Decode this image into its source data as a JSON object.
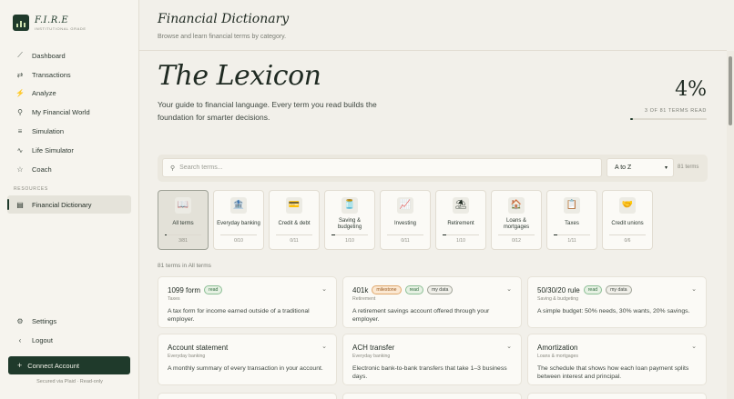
{
  "brand": {
    "name": "F.I.R.E",
    "tagline": "INSTITUTIONAL GRADE"
  },
  "nav": [
    {
      "label": "Dashboard",
      "icon": "chart-line-icon",
      "glyph": "⟋"
    },
    {
      "label": "Transactions",
      "icon": "arrows-swap-icon",
      "glyph": "⇄"
    },
    {
      "label": "Analyze",
      "icon": "pulse-icon",
      "glyph": "⚡"
    },
    {
      "label": "My Financial World",
      "icon": "microphone-icon",
      "glyph": "⚲"
    },
    {
      "label": "Simulation",
      "icon": "sliders-icon",
      "glyph": "≡"
    },
    {
      "label": "Life Simulator",
      "icon": "pulse-line-icon",
      "glyph": "∿"
    },
    {
      "label": "Coach",
      "icon": "star-icon",
      "glyph": "☆"
    }
  ],
  "resources_label": "RESOURCES",
  "active_item": {
    "label": "Financial Dictionary",
    "icon": "book-icon",
    "glyph": "▤"
  },
  "bottom_nav": [
    {
      "label": "Settings",
      "icon": "gear-icon",
      "glyph": "⚙"
    },
    {
      "label": "Logout",
      "icon": "chevron-left-icon",
      "glyph": "‹"
    }
  ],
  "connect": {
    "label": "Connect Account",
    "secured": "Secured via Plaid · Read-only"
  },
  "header": {
    "title": "Financial Dictionary",
    "subtitle": "Browse and learn financial terms by category."
  },
  "hero": {
    "title": "The Lexicon",
    "description": "Your guide to financial language. Every term you read builds the foundation for smarter decisions.",
    "percent": "4%",
    "read_count": "3 OF 81 TERMS READ",
    "progress": 0.04
  },
  "search": {
    "placeholder": "Search terms...",
    "value": ""
  },
  "sort": {
    "selected": "A to Z"
  },
  "term_count": "81 terms",
  "categories": [
    {
      "label": "All terms",
      "count": "3/81",
      "progress": 0.04,
      "glyph": "📖",
      "icon": "book-icon",
      "active": true
    },
    {
      "label": "Everyday banking",
      "count": "0/10",
      "progress": 0,
      "glyph": "🏦",
      "icon": "bank-icon"
    },
    {
      "label": "Credit & debt",
      "count": "0/11",
      "progress": 0,
      "glyph": "💳",
      "icon": "credit-card-icon"
    },
    {
      "label": "Saving & budgeting",
      "count": "1/10",
      "progress": 0.1,
      "glyph": "🫙",
      "icon": "jar-icon"
    },
    {
      "label": "Investing",
      "count": "0/11",
      "progress": 0,
      "glyph": "📈",
      "icon": "chart-up-icon"
    },
    {
      "label": "Retirement",
      "count": "1/10",
      "progress": 0.1,
      "glyph": "⛱",
      "icon": "umbrella-icon"
    },
    {
      "label": "Loans & mortgages",
      "count": "0/12",
      "progress": 0,
      "glyph": "🏠",
      "icon": "house-icon"
    },
    {
      "label": "Taxes",
      "count": "1/11",
      "progress": 0.09,
      "glyph": "📋",
      "icon": "clipboard-icon"
    },
    {
      "label": "Credit unions",
      "count": "0/6",
      "progress": 0,
      "glyph": "🤝",
      "icon": "handshake-icon"
    }
  ],
  "results_label": "81 terms in All terms",
  "terms": [
    {
      "title": "1099 form",
      "badges": [
        "read"
      ],
      "category": "Taxes",
      "description": "A tax form for income earned outside of a traditional employer."
    },
    {
      "title": "401k",
      "badges": [
        "milestone",
        "read",
        "my data"
      ],
      "category": "Retirement",
      "description": "A retirement savings account offered through your employer."
    },
    {
      "title": "50/30/20 rule",
      "badges": [
        "read",
        "my data"
      ],
      "category": "Saving & budgeting",
      "description": "A simple budget: 50% needs, 30% wants, 20% savings."
    },
    {
      "title": "Account statement",
      "badges": [],
      "category": "Everyday banking",
      "description": "A monthly summary of every transaction in your account."
    },
    {
      "title": "ACH transfer",
      "badges": [],
      "category": "Everyday banking",
      "description": "Electronic bank-to-bank transfers that take 1–3 business days."
    },
    {
      "title": "Amortization",
      "badges": [],
      "category": "Loans & mortgages",
      "description": "The schedule that shows how each loan payment splits between interest and principal."
    }
  ]
}
